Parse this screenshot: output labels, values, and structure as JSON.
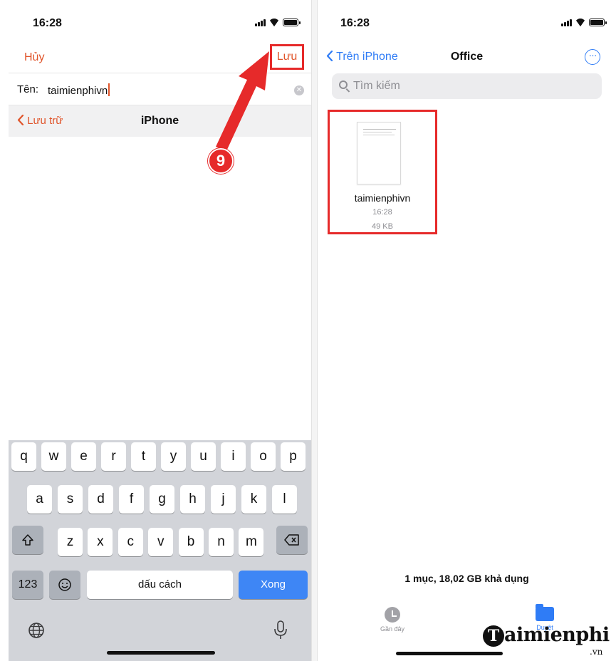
{
  "left_screen": {
    "status": {
      "time": "16:28"
    },
    "nav": {
      "cancel_label": "Hủy",
      "save_label": "Lưu"
    },
    "name_field": {
      "label": "Tên:",
      "value": "taimienphivn"
    },
    "location": {
      "back_label": "Lưu trữ",
      "title": "iPhone"
    },
    "keyboard": {
      "row1": [
        "q",
        "w",
        "e",
        "r",
        "t",
        "y",
        "u",
        "i",
        "o",
        "p"
      ],
      "row2": [
        "a",
        "s",
        "d",
        "f",
        "g",
        "h",
        "j",
        "k",
        "l"
      ],
      "row3": [
        "z",
        "x",
        "c",
        "v",
        "b",
        "n",
        "m"
      ],
      "numbers_label": "123",
      "space_label": "dấu cách",
      "done_label": "Xong"
    }
  },
  "callout": {
    "step_number": "9",
    "color": "#e62a2a"
  },
  "right_screen": {
    "status": {
      "time": "16:28"
    },
    "nav": {
      "back_label": "Trên iPhone",
      "title": "Office"
    },
    "search": {
      "placeholder": "Tìm kiếm"
    },
    "file": {
      "name": "taimienphivn",
      "time": "16:28",
      "size": "49 KB"
    },
    "storage_text": "1 mục, 18,02 GB khả dụng",
    "tabs": [
      {
        "label": "Gần đây",
        "icon": "clock-icon"
      },
      {
        "label": "Duyệt",
        "icon": "folder-icon"
      }
    ]
  },
  "watermark": {
    "brand": "aimienphi",
    "logo_letter": "T",
    "domain": ".vn"
  },
  "colors": {
    "accent_orange": "#e0542a",
    "ios_blue": "#2f7cf6",
    "highlight_red": "#e62a2a"
  }
}
